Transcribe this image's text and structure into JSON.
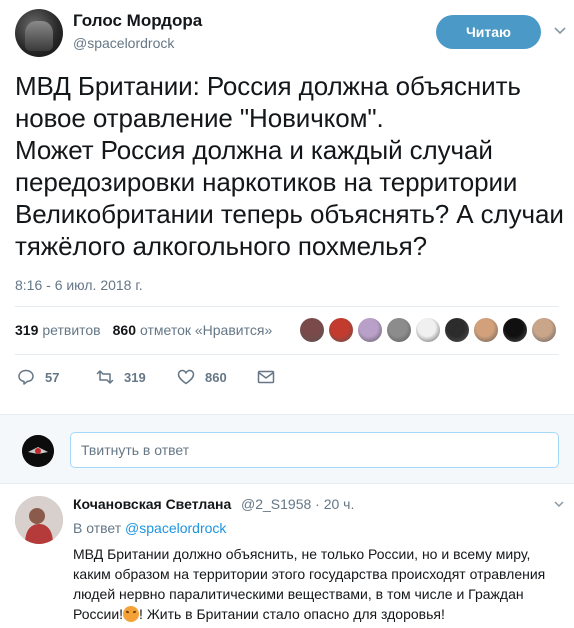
{
  "tweet": {
    "display_name": "Голос Мордора",
    "screen_name": "@spacelordrock",
    "follow_label": "Читаю",
    "text": "МВД Британии: Россия должна объяснить новое отравление \"Новичком\".\nМожет Россия должна и каждый случай передозировки наркотиков на территории Великобритании теперь объяснять? А случаи тяжёлого алкогольного похмелья?",
    "timestamp": "8:16 - 6 июл. 2018 г."
  },
  "stats": {
    "retweets_count": "319",
    "retweets_label": "ретвитов",
    "likes_count": "860",
    "likes_label": "отметок «Нравится»",
    "likers": [
      {
        "icon": "liker-avatar-1",
        "color": "#7a4a4a"
      },
      {
        "icon": "liker-avatar-2",
        "color": "#c23b2e"
      },
      {
        "icon": "liker-avatar-3",
        "color": "#b9a0c8"
      },
      {
        "icon": "liker-avatar-4",
        "color": "#8c8c8c"
      },
      {
        "icon": "liker-avatar-5",
        "color": "#f0f0f0"
      },
      {
        "icon": "liker-avatar-6",
        "color": "#2c2c2c"
      },
      {
        "icon": "liker-avatar-7",
        "color": "#d2a07a"
      },
      {
        "icon": "liker-avatar-8",
        "color": "#101010"
      },
      {
        "icon": "liker-avatar-9",
        "color": "#c9a58a"
      }
    ]
  },
  "actions": {
    "reply_count": "57",
    "retweet_count": "319",
    "like_count": "860"
  },
  "reply_box": {
    "placeholder": "Твитнуть в ответ"
  },
  "reply": {
    "name": "Кочановская Светлана",
    "handle": "@2_S1958 · 20 ч.",
    "in_reply_prefix": "В ответ",
    "in_reply_handle": "@spacelordrock",
    "text_before_emoji": "МВД Британии должно объяснить, не только России, но и всему миру, каким образом на территории этого государства происходят отравления людей нервно паралитическими веществами, в том числе и Граждан России!",
    "text_after_emoji": "! Жить в Британии стало опасно для здоровья!"
  },
  "colors": {
    "accent": "#1b95e0",
    "follow_button": "#4a99c7",
    "muted_text": "#657786"
  }
}
